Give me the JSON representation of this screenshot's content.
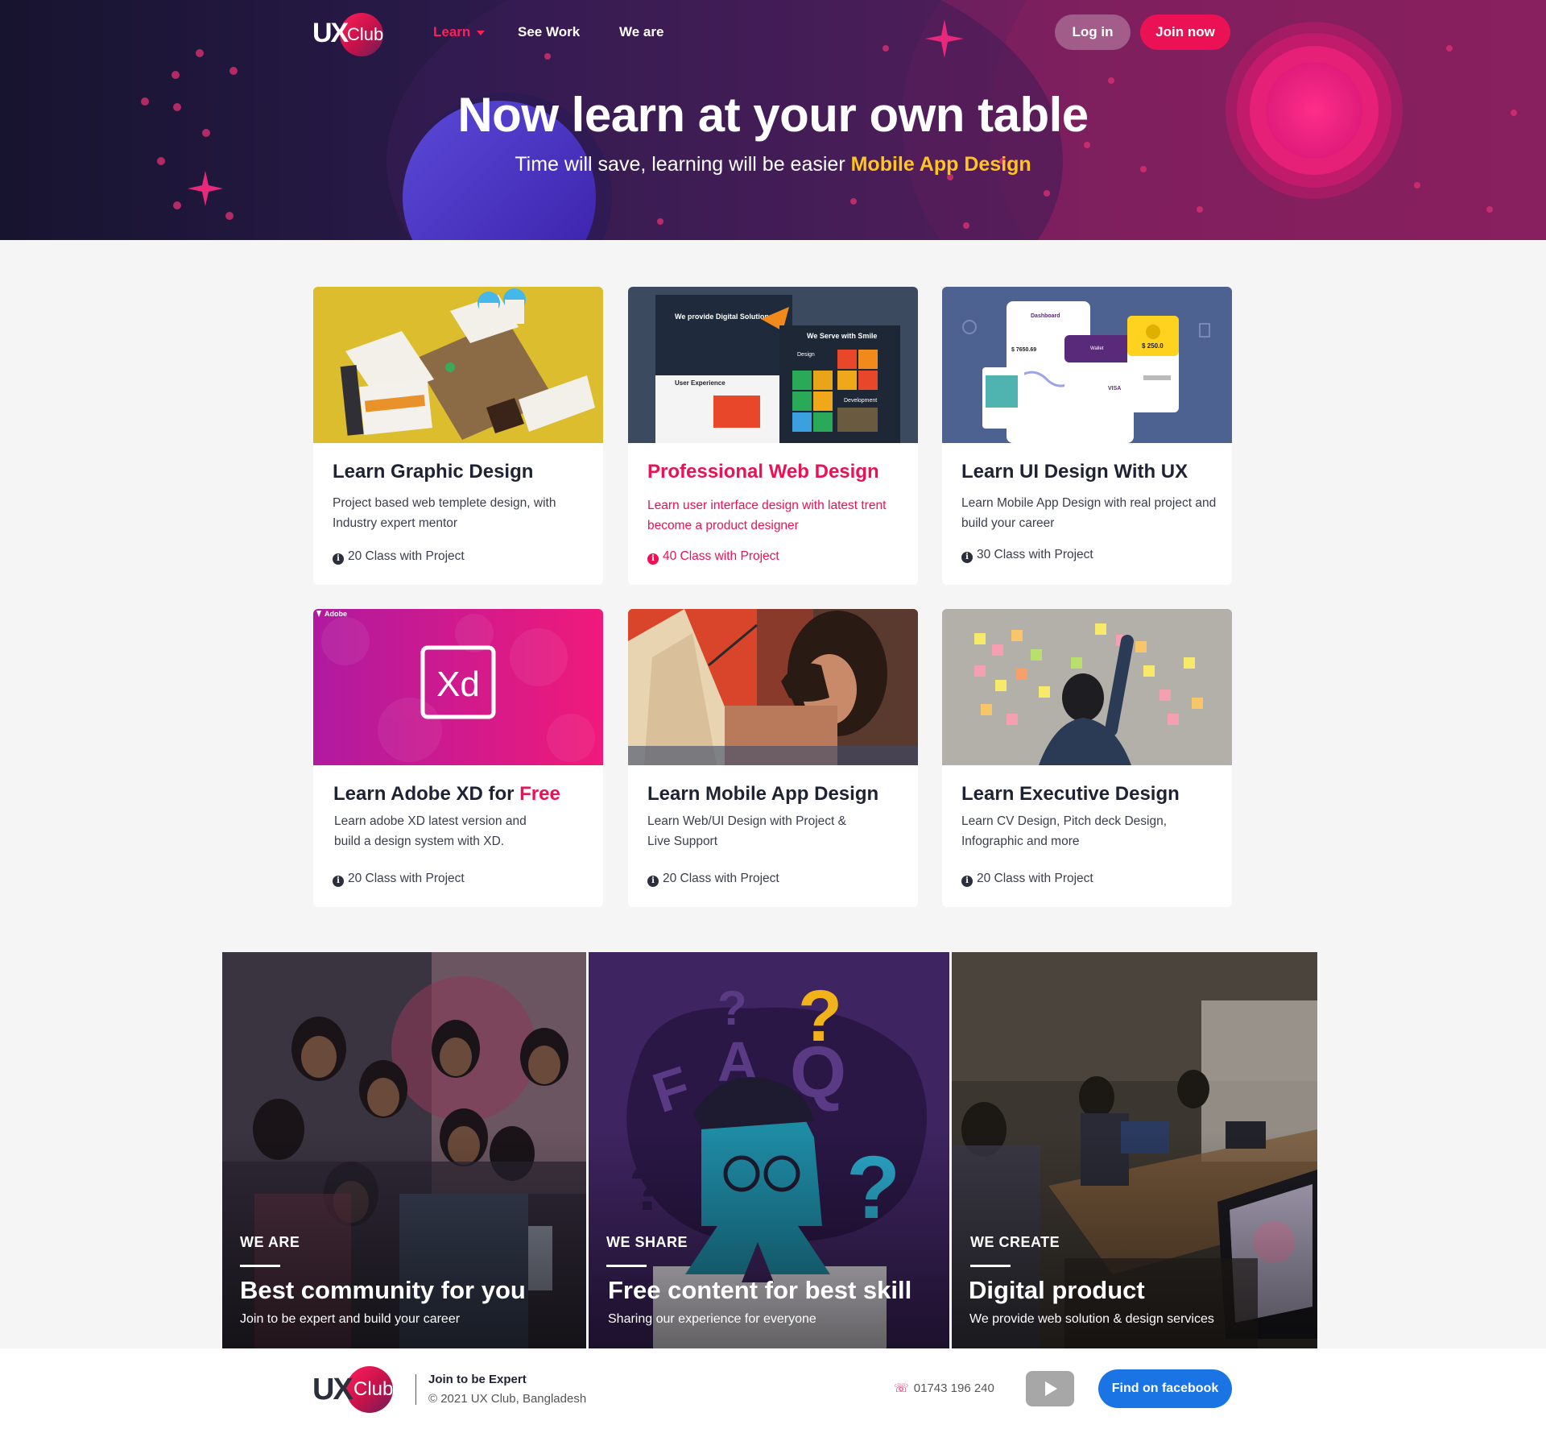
{
  "nav": {
    "logo_ux": "UX",
    "logo_club": "Club",
    "links": [
      "Learn",
      "See Work",
      "We are"
    ],
    "login": "Log in",
    "join": "Join now"
  },
  "hero": {
    "title": "Now learn at your own table",
    "subtitle": "Time will save, learning will be easier",
    "highlight": "Mobile App Design"
  },
  "courses": [
    {
      "title": "Learn Graphic Design",
      "desc": "Project based web templete design, with Industry expert mentor",
      "meta": "20 Class with Project"
    },
    {
      "title": "Professional  Web Design",
      "desc": "Learn user interface design with latest trent become a product designer",
      "meta": "40 Class with Project"
    },
    {
      "title": "Learn UI Design With UX",
      "desc": "Learn Mobile App Design with real project and build your career",
      "meta": "30 Class with Project"
    },
    {
      "title": "Learn Adobe XD for",
      "title_accent": "Free",
      "desc": "Learn adobe XD latest version and build a design system with XD.",
      "meta": "20 Class with Project",
      "thumb_brand": "Adobe",
      "thumb_mark": "Xd"
    },
    {
      "title": "Learn Mobile App Design",
      "desc": "Learn Web/UI Design with Project & Live Support",
      "meta": "20 Class with Project"
    },
    {
      "title": "Learn Executive Design",
      "desc": "Learn CV Design, Pitch deck Design, Infographic and more",
      "meta": "20 Class with Project"
    }
  ],
  "thumb_texts": {
    "web_1": "We provide Digital Solutions",
    "web_2": "We Serve with Smile",
    "web_3": "User Experience",
    "web_4": "Design",
    "web_5": "Development",
    "ui_1": "Dashboard",
    "ui_2": "$ 7650.69",
    "ui_3": "$ 250.0",
    "ui_4": "Wallet",
    "ui_5": "VISA"
  },
  "features": [
    {
      "kicker": "WE ARE",
      "title": "Best community for you",
      "sub": "Join to be expert and build your career"
    },
    {
      "kicker": "WE SHARE",
      "title": "Free content for best skill",
      "sub": "Sharing our experience for everyone"
    },
    {
      "kicker": "WE CREATE",
      "title": "Digital product",
      "sub": "We provide web solution & design services"
    }
  ],
  "faq_letters": [
    "F",
    "A",
    "Q"
  ],
  "footer": {
    "tagline": "Join to be Expert",
    "copyright": "© 2021 UX Club, Bangladesh",
    "phone": "01743 196 240",
    "facebook": "Find on facebook"
  },
  "colors": {
    "accent": "#ea1254",
    "highlight": "#ffc51f",
    "facebook": "#1b74e4"
  }
}
